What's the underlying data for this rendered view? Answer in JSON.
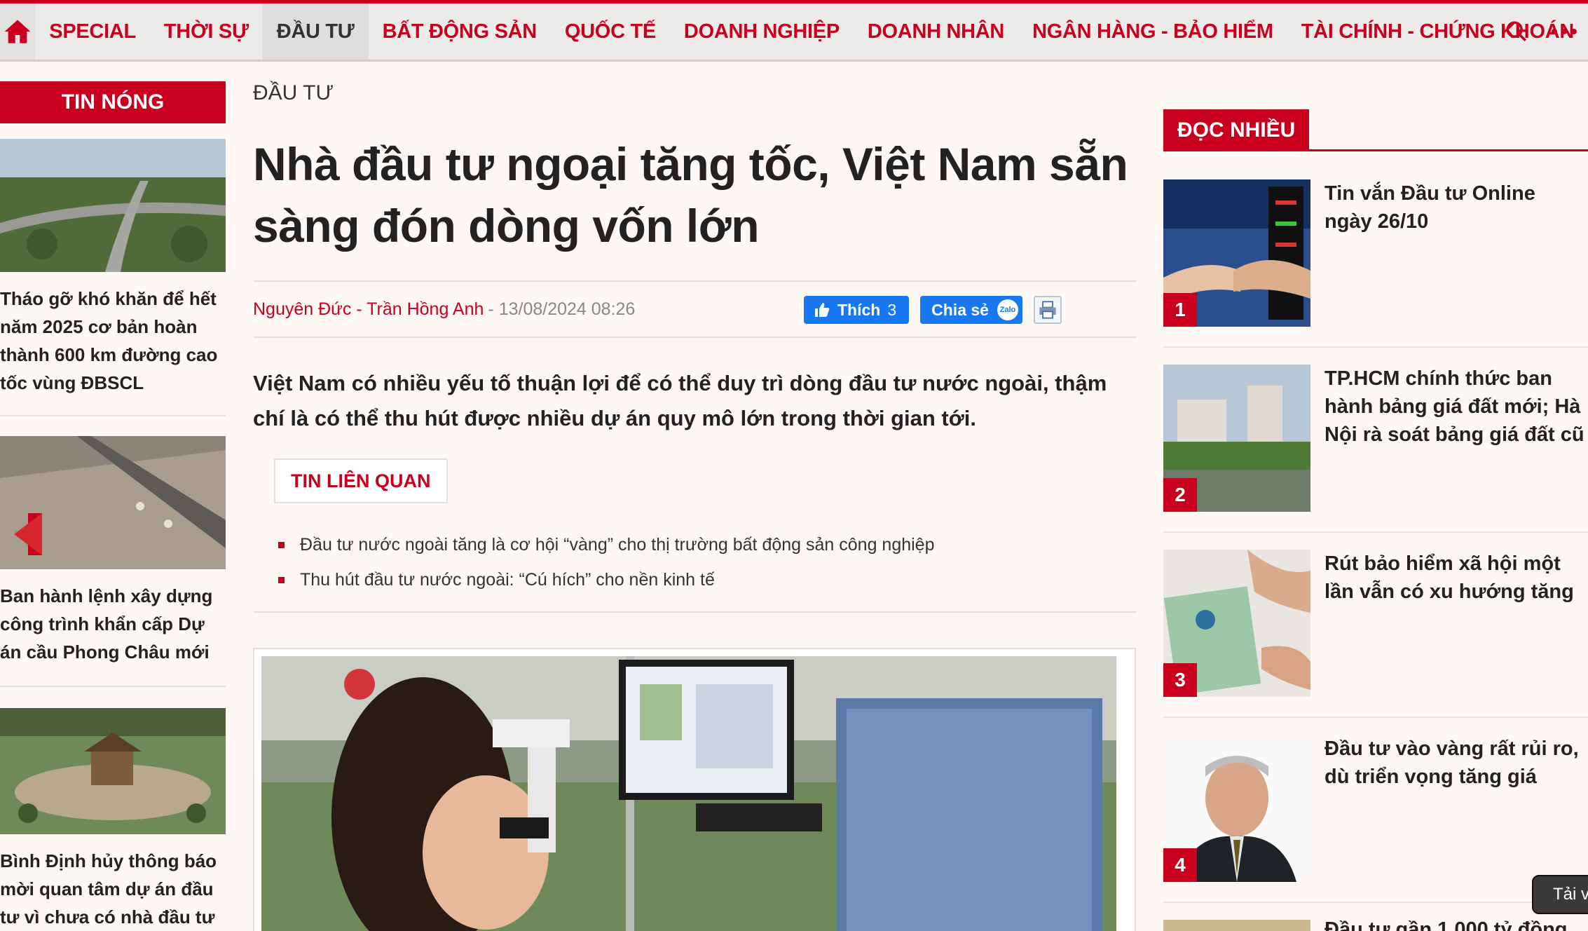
{
  "nav": {
    "home_icon": "home-icon",
    "items": [
      "SPECIAL",
      "THỜI SỰ",
      "ĐẦU TƯ",
      "BẤT ĐỘNG SẢN",
      "QUỐC TẾ",
      "DOANH NGHIỆP",
      "DOANH NHÂN",
      "NGÂN HÀNG - BẢO HIỂM",
      "TÀI CHÍNH - CHỨNG KHOÁN"
    ],
    "active": "ĐẦU TƯ",
    "search_icon": "search-icon",
    "more_icon": "more-icon"
  },
  "hot_news": {
    "title": "TIN NÓNG",
    "items": [
      "Tháo gỡ khó khăn để hết năm 2025 cơ bản hoàn thành 600 km đường cao tốc vùng ĐBSCL",
      "Ban hành lệnh xây dựng công trình khẩn cấp Dự án cầu Phong Châu mới",
      "Bình Định hủy thông báo mời quan tâm dự án đầu tư vì chưa có nhà đầu tư"
    ]
  },
  "article": {
    "category": "ĐẦU TƯ",
    "title": "Nhà đầu tư ngoại tăng tốc, Việt Nam sẵn sàng đón dòng vốn lớn",
    "author": "Nguyên Đức - Trần Hồng Anh",
    "date": "- 13/08/2024 08:26",
    "like_label": "Thích",
    "like_count": "3",
    "share_label": "Chia sẻ",
    "zalo_label": "Zalo",
    "sapo": "Việt Nam có nhiều yếu tố thuận lợi để có thể duy trì dòng đầu tư nước ngoài, thậm chí là có thể thu hút được nhiều dự án quy mô lớn trong thời gian tới.",
    "related_title": "TIN LIÊN QUAN",
    "related": [
      "Đầu tư nước ngoài tăng là cơ hội “vàng” cho thị trường bất động sản công nghiệp",
      "Thu hút đầu tư nước ngoài: “Cú hích” cho nền kinh tế"
    ]
  },
  "most_read": {
    "title": "ĐỌC NHIỀU",
    "items": [
      {
        "rank": "1",
        "title": "Tin vắn Đầu tư Online ngày 26/10"
      },
      {
        "rank": "2",
        "title": "TP.HCM chính thức ban hành bảng giá đất mới; Hà Nội rà soát bảng giá đất cũ"
      },
      {
        "rank": "3",
        "title": "Rút bảo hiểm xã hội một lần vẫn có xu hướng tăng"
      },
      {
        "rank": "4",
        "title": "Đầu tư vào vàng rất rủi ro, dù triển vọng tăng giá"
      },
      {
        "rank": "",
        "title": "Đầu tư gần 1.000 tỷ đồng"
      }
    ]
  },
  "tooltip": "Tải v",
  "colors": {
    "brand": "#c8001e",
    "facebook": "#1877f2"
  }
}
